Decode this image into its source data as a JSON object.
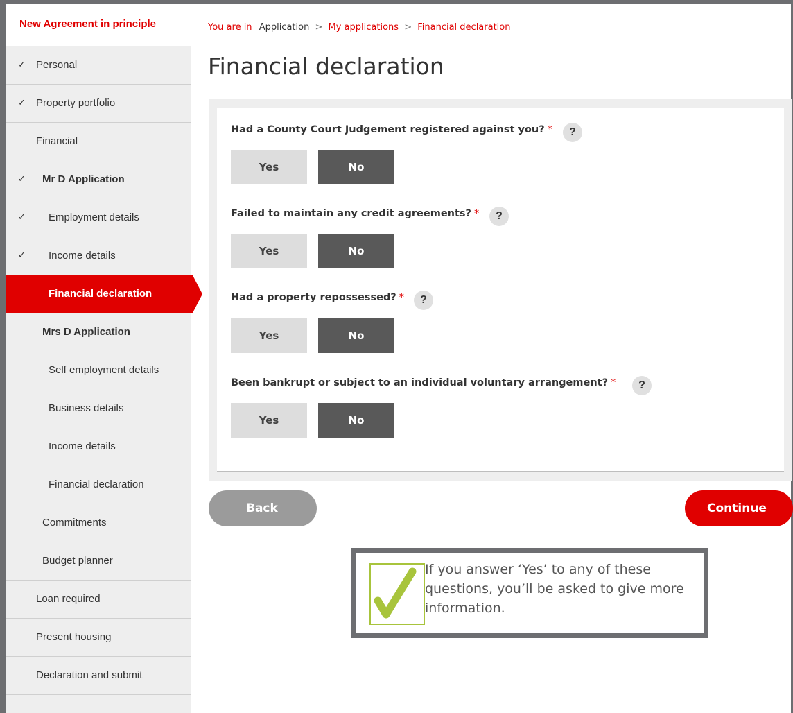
{
  "sidebar": {
    "header": "New Agreement in principle",
    "items": [
      {
        "label": "Personal",
        "check": "✓"
      },
      {
        "label": "Property portfolio",
        "check": "✓"
      },
      {
        "label": "Financial",
        "check": ""
      },
      {
        "label": "Mr D Application",
        "check": "✓"
      },
      {
        "label": "Employment details",
        "check": "✓"
      },
      {
        "label": "Income details",
        "check": "✓"
      },
      {
        "label": "Financial declaration",
        "check": ""
      },
      {
        "label": "Mrs D Application",
        "check": ""
      },
      {
        "label": "Self employment details",
        "check": ""
      },
      {
        "label": "Business details",
        "check": ""
      },
      {
        "label": "Income details",
        "check": ""
      },
      {
        "label": "Financial declaration",
        "check": ""
      },
      {
        "label": "Commitments",
        "check": ""
      },
      {
        "label": "Budget planner",
        "check": ""
      },
      {
        "label": "Loan required",
        "check": ""
      },
      {
        "label": "Present housing",
        "check": ""
      },
      {
        "label": "Declaration and submit",
        "check": ""
      }
    ],
    "active_item": "Financial declaration"
  },
  "breadcrumb": {
    "prefix": "You are in",
    "items": [
      "Application",
      "My applications",
      "Financial declaration"
    ],
    "separator": ">"
  },
  "page_title": "Financial declaration",
  "questions": [
    {
      "text": "Had a County Court Judgement registered against you?",
      "required": "*",
      "help": "?",
      "yes": "Yes",
      "no": "No",
      "selected": "No"
    },
    {
      "text": "Failed to maintain any credit agreements?",
      "required": "*",
      "help": "?",
      "yes": "Yes",
      "no": "No",
      "selected": "No"
    },
    {
      "text": "Had a property repossessed?",
      "required": "*",
      "help": "?",
      "yes": "Yes",
      "no": "No",
      "selected": "No"
    },
    {
      "text": "Been bankrupt or subject to an individual voluntary arrangement?",
      "required": "*",
      "help": "?",
      "yes": "Yes",
      "no": "No",
      "selected": "No"
    }
  ],
  "buttons": {
    "back": "Back",
    "continue": "Continue"
  },
  "info": {
    "icon": "check-icon",
    "text": "If you answer ‘Yes’ to any of these questions, you’ll be asked to give more information."
  },
  "colors": {
    "brand_red": "#e00000",
    "selected_dark": "#595959",
    "unselected": "#dddddd",
    "tick_green": "#a8c43c"
  }
}
